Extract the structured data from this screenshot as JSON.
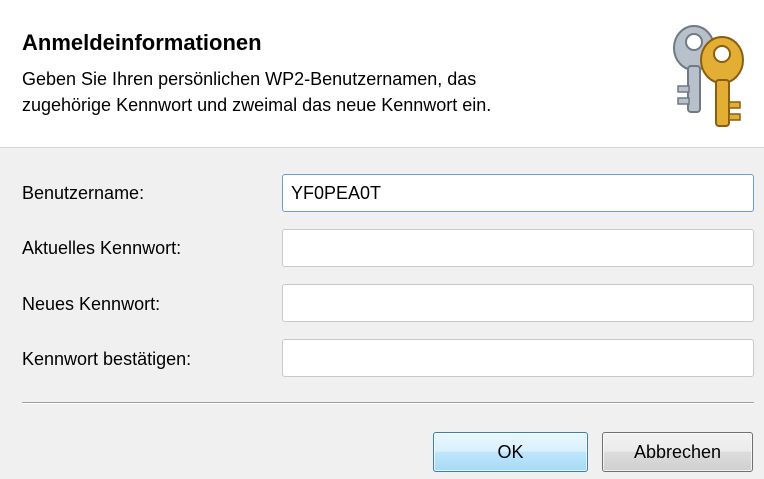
{
  "header": {
    "title": "Anmeldeinformationen",
    "description_line1": "Geben Sie Ihren persönlichen WP2-Benutzernamen, das",
    "description_line2": "zugehörige Kennwort und zweimal das neue Kennwort ein.",
    "icon": "keys-icon"
  },
  "form": {
    "username_label": "Benutzername:",
    "username_value": "YF0PEA0T",
    "current_password_label": "Aktuelles Kennwort:",
    "current_password_value": "",
    "new_password_label": "Neues Kennwort:",
    "new_password_value": "",
    "confirm_password_label": "Kennwort bestätigen:",
    "confirm_password_value": ""
  },
  "buttons": {
    "ok_label": "OK",
    "cancel_label": "Abbrechen"
  },
  "colors": {
    "focus_border": "#6d9ed4",
    "ok_border": "#3c7fb1",
    "key_gold": "#d9a72e",
    "key_silver": "#a9b2bd"
  }
}
